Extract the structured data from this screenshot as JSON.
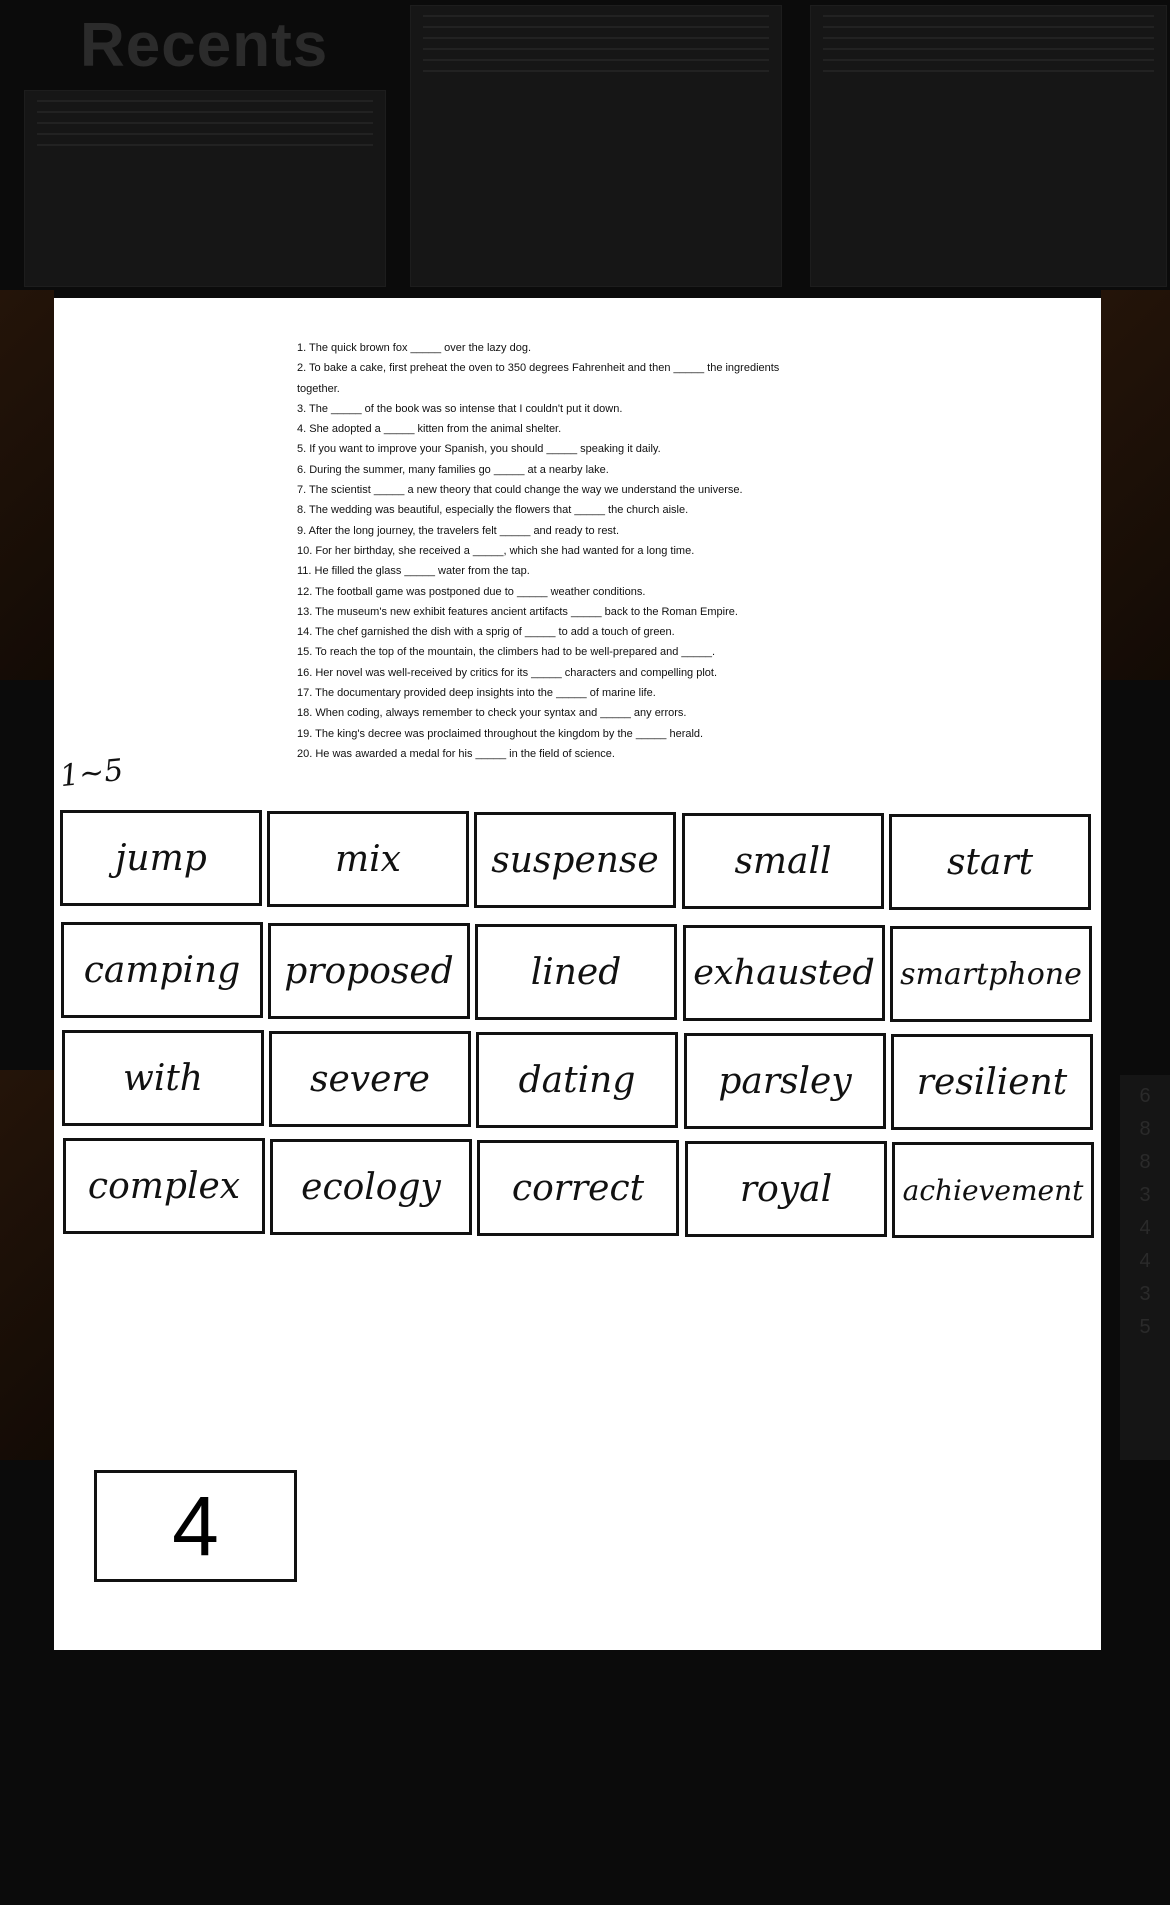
{
  "background": {
    "title": "Recents"
  },
  "worksheet": {
    "questions": [
      "1. The quick brown fox _____ over the lazy dog.",
      "2. To bake a cake, first preheat the oven to 350 degrees Fahrenheit and then _____ the ingredients",
      "together.",
      "3. The _____ of the book was so intense that I couldn't put it down.",
      "4. She adopted a _____ kitten from the animal shelter.",
      "5. If you want to improve your Spanish, you should _____ speaking it daily.",
      "6. During the summer, many families go _____ at a nearby lake.",
      "7. The scientist _____ a new theory that could change the way we understand the universe.",
      "8. The wedding was beautiful, especially the flowers that _____ the church aisle.",
      "9. After the long journey, the travelers felt _____ and ready to rest.",
      "10. For her birthday, she received a _____, which she had wanted for a long time.",
      "11. He filled the glass _____ water from the tap.",
      "12. The football game was postponed due to _____ weather conditions.",
      "13. The museum's new exhibit features ancient artifacts _____ back to the Roman Empire.",
      "14. The chef garnished the dish with a sprig of _____ to add a touch of green.",
      "15. To reach the top of the mountain, the climbers had to be well-prepared and _____.",
      "16. Her novel was well-received by critics for its _____ characters and compelling plot.",
      "17. The documentary provided deep insights into the _____ of marine life.",
      "18. When coding, always remember to check your syntax and _____ any errors.",
      "19. The king's decree was proclaimed throughout the kingdom by the _____ herald.",
      "20. He was awarded a medal for his _____ in the field of science."
    ],
    "range_label": "1~5",
    "word_rows": [
      [
        "jump",
        "mix",
        "suspense",
        "small",
        "start"
      ],
      [
        "camping",
        "proposed",
        "lined",
        "exhausted",
        "smartphone"
      ],
      [
        "with",
        "severe",
        "dating",
        "parsley",
        "resilient"
      ],
      [
        "complex",
        "ecology",
        "correct",
        "royal",
        "achievement"
      ]
    ],
    "count_value": "4"
  }
}
